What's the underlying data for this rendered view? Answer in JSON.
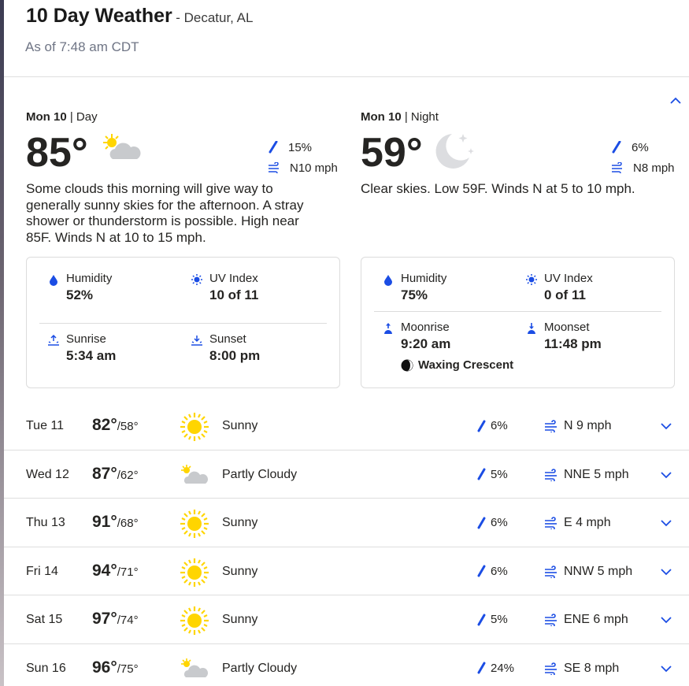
{
  "header": {
    "title": "10 Day Weather",
    "location": "- Decatur, AL",
    "as_of": "As of 7:48 am CDT"
  },
  "colors": {
    "accent": "#1b4de4",
    "sun": "#ffd500",
    "cloud": "#c8cacd"
  },
  "today": {
    "day": {
      "label_bold": "Mon 10",
      "label_sep": " | ",
      "label_part": "Day",
      "temp": "85°",
      "icon": "partly-cloudy-day-icon",
      "precip": "15%",
      "wind": "N10 mph",
      "narrative": "Some clouds this morning will give way to generally sunny skies for the afternoon. A stray shower or thunderstorm is possible. High near 85F. Winds N at 10 to 15 mph.",
      "details": {
        "humidity_label": "Humidity",
        "humidity": "52%",
        "uv_label": "UV Index",
        "uv": "10 of 11",
        "sunrise_label": "Sunrise",
        "sunrise": "5:34 am",
        "sunset_label": "Sunset",
        "sunset": "8:00 pm"
      }
    },
    "night": {
      "label_bold": "Mon 10",
      "label_sep": " | ",
      "label_part": "Night",
      "temp": "59°",
      "icon": "clear-night-moon-icon",
      "precip": "6%",
      "wind": "N8 mph",
      "narrative": "Clear skies. Low 59F. Winds N at 5 to 10 mph.",
      "details": {
        "humidity_label": "Humidity",
        "humidity": "75%",
        "uv_label": "UV Index",
        "uv": "0 of 11",
        "moonrise_label": "Moonrise",
        "moonrise": "9:20 am",
        "moonset_label": "Moonset",
        "moonset": "11:48 pm",
        "moon_phase": "Waxing Crescent"
      }
    }
  },
  "forecast": [
    {
      "day": "Tue 11",
      "high": "82°",
      "low": "/58°",
      "icon": "sunny",
      "condition": "Sunny",
      "precip": "6%",
      "wind": "N 9 mph"
    },
    {
      "day": "Wed 12",
      "high": "87°",
      "low": "/62°",
      "icon": "partly-cloudy",
      "condition": "Partly Cloudy",
      "precip": "5%",
      "wind": "NNE 5 mph"
    },
    {
      "day": "Thu 13",
      "high": "91°",
      "low": "/68°",
      "icon": "sunny",
      "condition": "Sunny",
      "precip": "6%",
      "wind": "E 4 mph"
    },
    {
      "day": "Fri 14",
      "high": "94°",
      "low": "/71°",
      "icon": "sunny",
      "condition": "Sunny",
      "precip": "6%",
      "wind": "NNW 5 mph"
    },
    {
      "day": "Sat 15",
      "high": "97°",
      "low": "/74°",
      "icon": "sunny",
      "condition": "Sunny",
      "precip": "5%",
      "wind": "ENE 6 mph"
    },
    {
      "day": "Sun 16",
      "high": "96°",
      "low": "/75°",
      "icon": "partly-cloudy",
      "condition": "Partly Cloudy",
      "precip": "24%",
      "wind": "SE 8 mph"
    }
  ]
}
